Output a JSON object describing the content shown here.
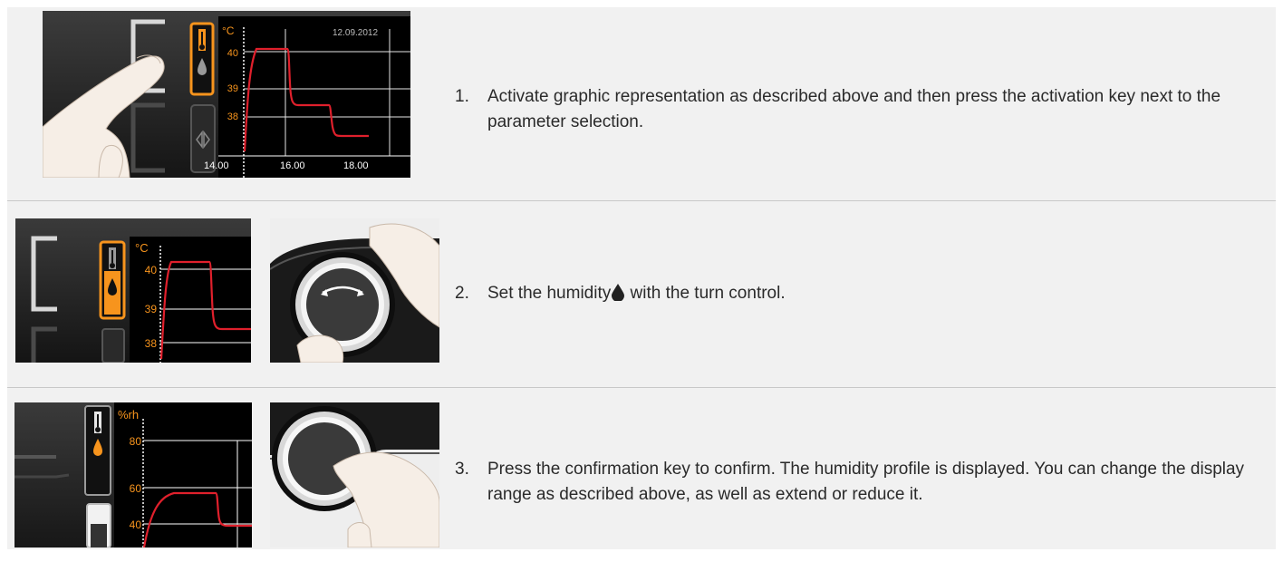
{
  "steps": [
    {
      "number": "1.",
      "text": "Activate graphic representation as described above and then press the activation key next to the parameter selection."
    },
    {
      "number": "2.",
      "text_before": "Set the humidity",
      "text_after": " with the turn control.",
      "inline_icon": "droplet-icon"
    },
    {
      "number": "3.",
      "text": "Press the confirmation key to confirm. The humidity profile is displayed. You can change the display range as described above, as well as extend or reduce it."
    }
  ],
  "display1": {
    "unit": "°C",
    "date": "12.09.2012",
    "y_ticks": [
      "40",
      "39",
      "38"
    ],
    "x_ticks": [
      "14.00",
      "16.00",
      "18.00"
    ],
    "icons": [
      "thermometer-icon",
      "droplet-icon",
      "arrows-icon"
    ]
  },
  "display2": {
    "unit": "°C",
    "y_ticks": [
      "40",
      "39",
      "38"
    ],
    "icons": [
      "thermometer-icon",
      "droplet-icon"
    ]
  },
  "display3": {
    "unit": "%rh",
    "y_ticks": [
      "80",
      "60",
      "40"
    ],
    "icons": [
      "thermometer-icon",
      "droplet-icon"
    ]
  },
  "colors": {
    "accent": "#f7941d",
    "curve": "#e0202c",
    "screen": "#000000",
    "row_bg": "#f1f1f1"
  }
}
